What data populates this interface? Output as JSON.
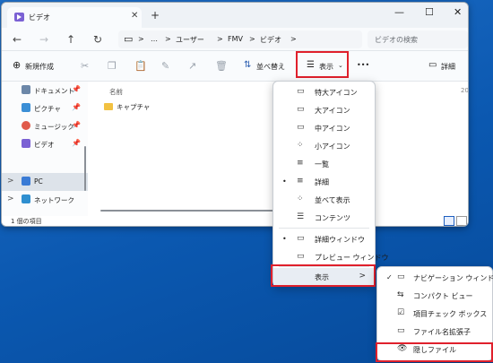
{
  "window": {
    "tab_title": "ビデオ",
    "tab_close": "✕",
    "new_tab": "+",
    "minimize": "—",
    "maximize": "☐",
    "close": "✕"
  },
  "nav": {
    "back": "←",
    "forward": "→",
    "up": "↑",
    "refresh": "↻"
  },
  "address": {
    "pc_icon": "▭",
    "sep1": ">",
    "ellipsis": "…",
    "sep2": ">",
    "crumb1": "ユーザー",
    "sep3": ">",
    "crumb2": "FMV",
    "sep4": ">",
    "crumb3": "ビデオ",
    "sep5": ">"
  },
  "search": {
    "placeholder": "ビデオの検索"
  },
  "toolbar": {
    "new_label": "新規作成",
    "sort_label": "並べ替え",
    "view_label": "表示",
    "more_label": "•••",
    "details_label": "詳細"
  },
  "sidebar": {
    "items": [
      {
        "label": "ドキュメント",
        "pinned": true
      },
      {
        "label": "ピクチャ",
        "pinned": true
      },
      {
        "label": "ミュージック",
        "pinned": true
      },
      {
        "label": "ビデオ",
        "pinned": true
      },
      {
        "label": "PC",
        "selected": true
      },
      {
        "label": "ネットワーク"
      }
    ],
    "pin_glyph": "📌",
    "chevron": ">"
  },
  "content": {
    "column_name": "名前",
    "column_right": "20",
    "items": [
      {
        "label": "キャプチャ"
      }
    ]
  },
  "status": {
    "item_count": "1 個の項目"
  },
  "view_menu": {
    "items": [
      {
        "label": "特大アイコン",
        "icon": "▭"
      },
      {
        "label": "大アイコン",
        "icon": "▭"
      },
      {
        "label": "中アイコン",
        "icon": "▭"
      },
      {
        "label": "小アイコン",
        "icon": "⁘"
      },
      {
        "label": "一覧",
        "icon": "≡"
      },
      {
        "label": "詳細",
        "icon": "≡",
        "bullet": "•"
      },
      {
        "label": "並べて表示",
        "icon": "⁘"
      },
      {
        "label": "コンテンツ",
        "icon": "☰"
      },
      {
        "label": "詳細ウィンドウ",
        "icon": "▭",
        "bullet": "•"
      },
      {
        "label": "プレビュー ウィンドウ",
        "icon": "▭"
      },
      {
        "label": "表示",
        "arrow": ">"
      }
    ]
  },
  "show_submenu": {
    "items": [
      {
        "label": "ナビゲーション ウィンドウ",
        "icon": "▭",
        "check": "✓"
      },
      {
        "label": "コンパクト ビュー",
        "icon": "⇆"
      },
      {
        "label": "項目チェック ボックス",
        "icon": "☑"
      },
      {
        "label": "ファイル名拡張子",
        "icon": "▭"
      },
      {
        "label": "隠しファイル",
        "icon": "👁"
      }
    ]
  },
  "colors": {
    "accent": "#1f5fbf",
    "highlight": "#e0202c",
    "folder": "#f2c141",
    "desktop": "#0a5bb3"
  }
}
